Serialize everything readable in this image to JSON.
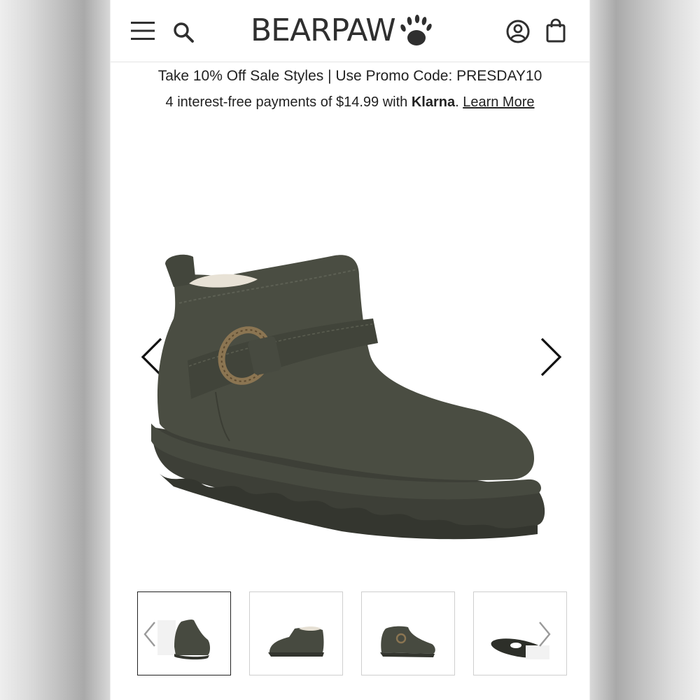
{
  "header": {
    "brand": "BEARPAW",
    "brand_color": "#2f2f2f"
  },
  "promo": {
    "sale_text": "Take 10% Off Sale Styles | Use Promo Code: PRESDAY10",
    "payment_prefix": "4 interest-free payments of $14.99 with ",
    "payment_brand": "Klarna",
    "payment_suffix": ". ",
    "learn_more": "Learn More"
  },
  "gallery": {
    "product_color": "#4a4d42",
    "thumbnail_count": 4,
    "active_thumbnail": 1
  }
}
